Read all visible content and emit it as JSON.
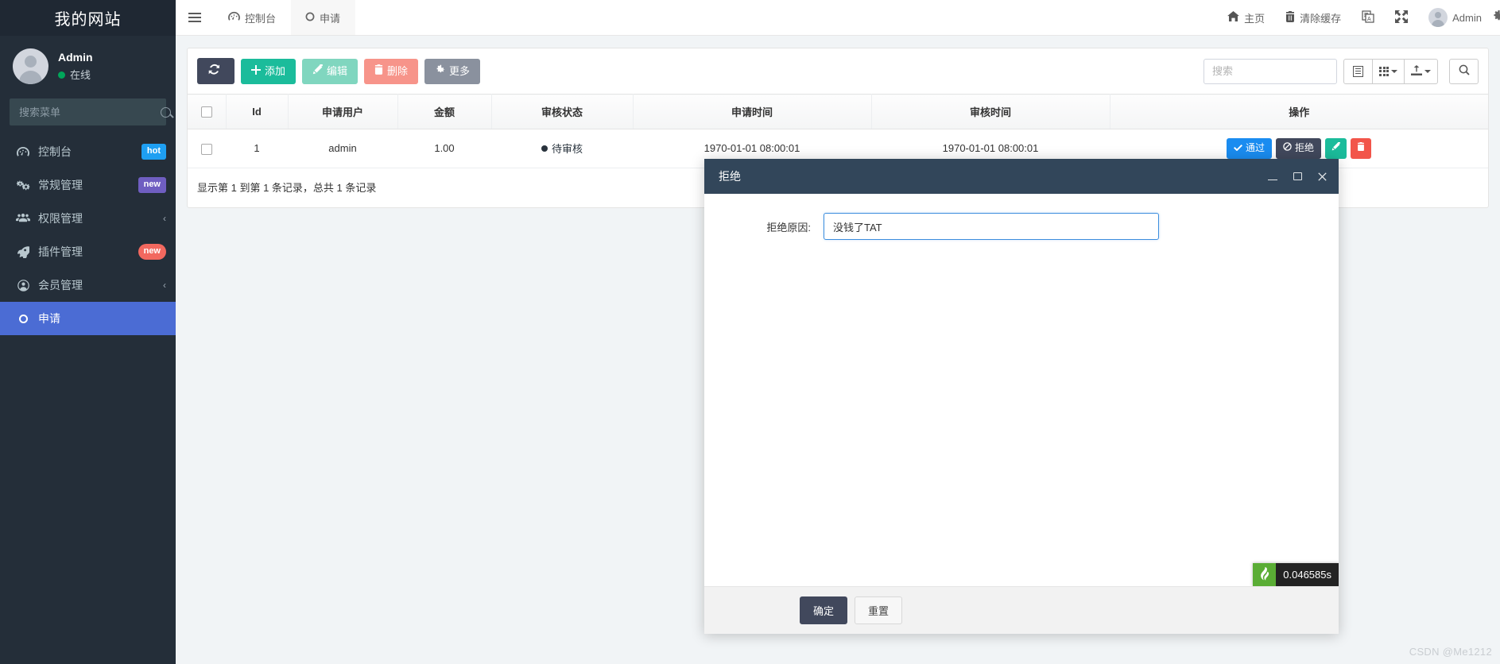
{
  "sidebar": {
    "site_title": "我的网站",
    "user": {
      "name": "Admin",
      "status": "在线"
    },
    "search_placeholder": "搜索菜单",
    "search_value": "",
    "items": [
      {
        "label": "控制台",
        "icon": "dashboard-icon",
        "badge": "hot",
        "badge_style": "hot",
        "arrow": ""
      },
      {
        "label": "常规管理",
        "icon": "cogs-icon",
        "badge": "new",
        "badge_style": "new-purple",
        "arrow": ""
      },
      {
        "label": "权限管理",
        "icon": "users-icon",
        "badge": "",
        "badge_style": "",
        "arrow": "‹"
      },
      {
        "label": "插件管理",
        "icon": "rocket-icon",
        "badge": "new",
        "badge_style": "new-red",
        "arrow": ""
      },
      {
        "label": "会员管理",
        "icon": "user-circle-icon",
        "badge": "",
        "badge_style": "",
        "arrow": "‹"
      },
      {
        "label": "申请",
        "icon": "circle-o-icon",
        "badge": "",
        "badge_style": "",
        "arrow": ""
      }
    ],
    "active_index": 5
  },
  "navbar": {
    "tabs": [
      {
        "label": "控制台",
        "icon": "dashboard-icon",
        "active": false
      },
      {
        "label": "申请",
        "icon": "circle-o-icon",
        "active": true
      }
    ],
    "right_items": [
      {
        "label": "主页",
        "icon": "home-icon"
      },
      {
        "label": "清除缓存",
        "icon": "trash-icon"
      },
      {
        "label": "",
        "icon": "language-icon"
      },
      {
        "label": "",
        "icon": "fullscreen-icon"
      },
      {
        "label": "Admin",
        "icon": "avatar-icon"
      }
    ]
  },
  "toolbar": {
    "refresh_label": "",
    "add_label": "添加",
    "edit_label": "编辑",
    "delete_label": "删除",
    "more_label": "更多",
    "search_placeholder": "搜索",
    "search_value": ""
  },
  "table": {
    "columns": [
      "",
      "Id",
      "申请用户",
      "金额",
      "审核状态",
      "申请时间",
      "审核时间",
      "操作"
    ],
    "rows": [
      {
        "id": "1",
        "user": "admin",
        "amount": "1.00",
        "status": "待审核",
        "apply_time": "1970-01-01 08:00:01",
        "audit_time": "1970-01-01 08:00:01",
        "ops": {
          "pass": "通过",
          "reject": "拒绝",
          "edit": "",
          "delete": ""
        }
      }
    ],
    "footer_text": "显示第 1 到第 1 条记录，总共 1 条记录"
  },
  "modal": {
    "title": "拒绝",
    "form": {
      "label": "拒绝原因:",
      "value": "没钱了TAT",
      "placeholder": ""
    },
    "trace_time": "0.046585s",
    "confirm_label": "确定",
    "reset_label": "重置"
  },
  "watermark": "CSDN @Me1212",
  "colors": {
    "sidebar_bg": "#242e39",
    "sidebar_active": "#4b6cd4",
    "modal_header": "#32465a",
    "primary_dark": "#41485c",
    "teal": "#1bbc9b",
    "blue": "#1a8cf0",
    "red": "#f2554a",
    "online": "#00a65a"
  }
}
